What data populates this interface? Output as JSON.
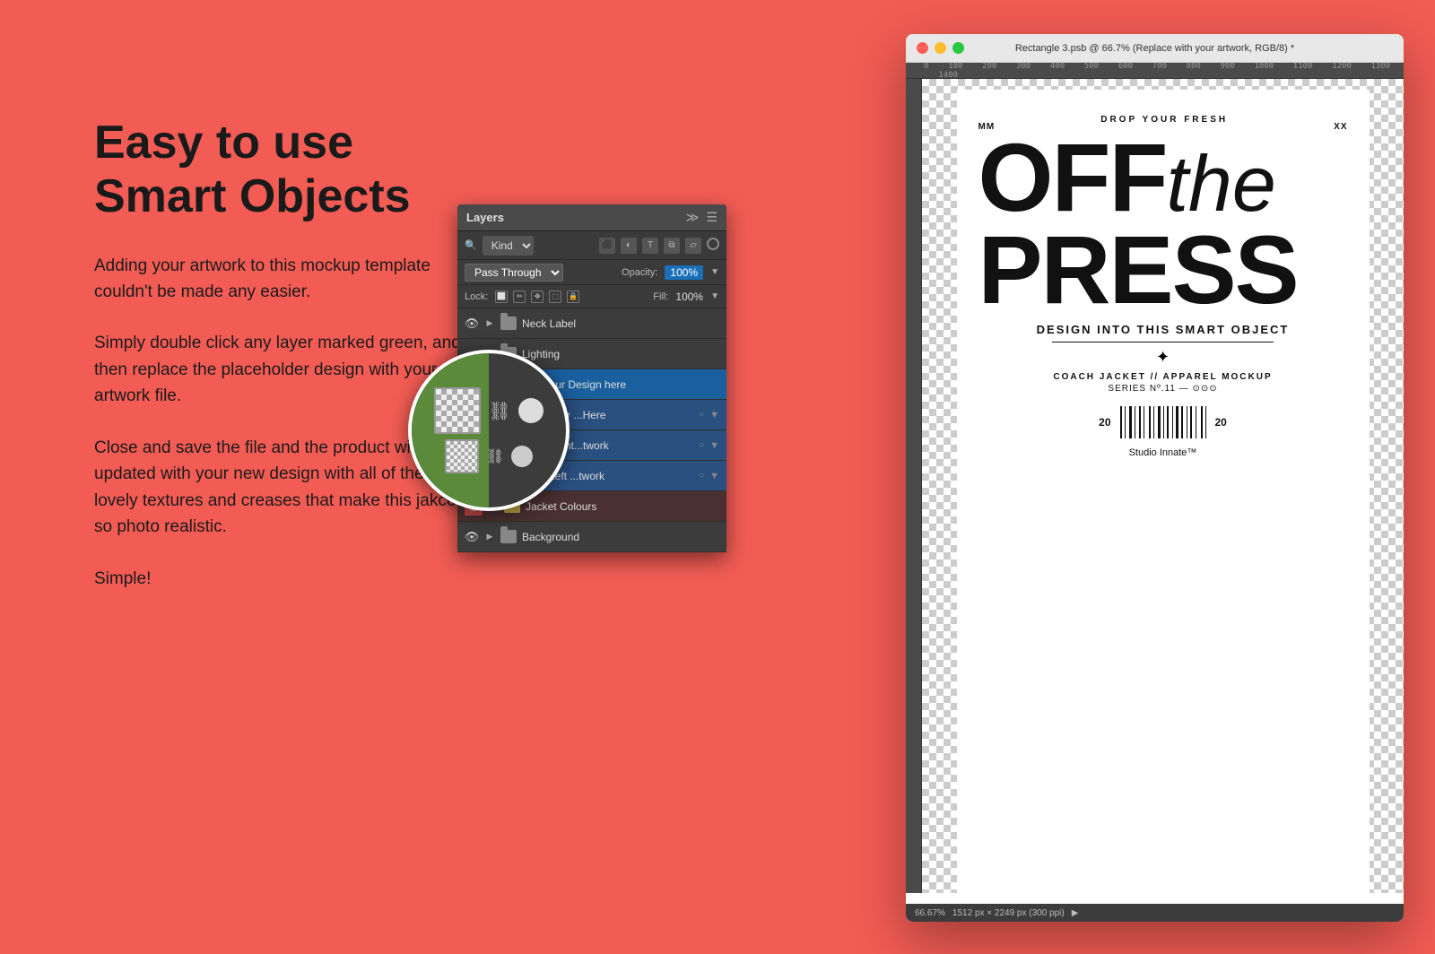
{
  "background_color": "#F25C54",
  "left_panel": {
    "heading": "Easy to use\nSmart Objects",
    "paragraphs": [
      "Adding your artwork to this mockup template couldn't be made any easier.",
      "Simply double click any layer marked green, and then replace the placeholder design with your artwork file.",
      "Close and save the file and the product will be updated with your new design with all of the lovely textures and creases that make this jakcet so photo realistic.",
      "Simple!"
    ]
  },
  "ps_window": {
    "title": "Rectangle 3.psb @ 66.7% (Replace with your artwork, RGB/8) *",
    "status_text": "66.67%",
    "dimensions_text": "1512 px × 2249 px (300 ppi)",
    "canvas": {
      "mag_top": "DROP YOUR FRESH",
      "mag_off": "OFF",
      "mag_the": "the",
      "mag_press": "PRESS",
      "mag_mm": "MM",
      "mag_xx": "XX",
      "mag_subtitle": "DESIGN INTO THIS SMART OBJECT",
      "mag_brand": "COACH JACKET // APPAREL MOCKUP",
      "mag_series": "SERIES Nº.11 — ⊙⊙⊙",
      "mag_year_left": "20",
      "mag_year_right": "20",
      "mag_studio": "Studio Innate™"
    }
  },
  "layers_panel": {
    "title": "Layers",
    "filter_label": "Kind",
    "blend_mode": "Pass Through",
    "opacity_label": "Opacity:",
    "opacity_value": "100%",
    "lock_label": "Lock:",
    "fill_label": "Fill:",
    "fill_value": "100%",
    "layers": [
      {
        "name": "Neck Label",
        "type": "folder",
        "visible": true,
        "color": "default",
        "expanded": false
      },
      {
        "name": "Lighting",
        "type": "folder",
        "visible": false,
        "color": "default",
        "expanded": false
      },
      {
        "name": "Your Design here",
        "type": "folder",
        "visible": true,
        "color": "default",
        "expanded": true,
        "selected": true
      },
      {
        "name": "Your ...Here",
        "type": "smart",
        "visible": true,
        "indent": true
      },
      {
        "name": "Right...twork",
        "type": "smart",
        "visible": true,
        "indent": true
      },
      {
        "name": "Left ...twork",
        "type": "smart",
        "visible": true,
        "indent": true
      },
      {
        "name": "Jacket Colours",
        "type": "folder",
        "visible": true,
        "color": "yellow",
        "expanded": false
      },
      {
        "name": "Background",
        "type": "folder",
        "visible": true,
        "color": "default",
        "expanded": false
      }
    ]
  }
}
